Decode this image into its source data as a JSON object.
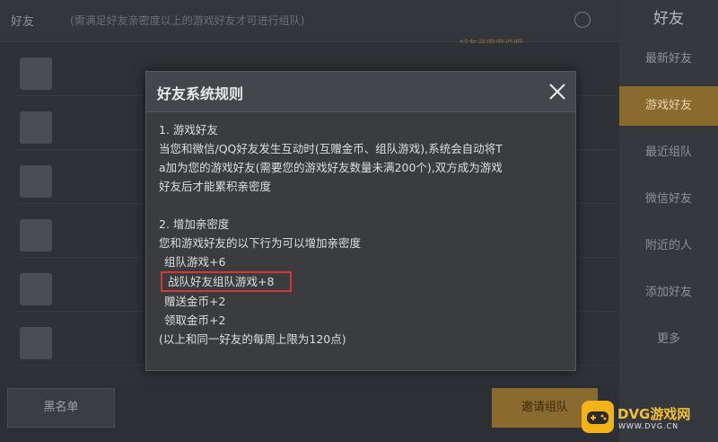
{
  "background": {
    "top_title": "好友",
    "top_hint": "(需满足好友亲密度以上的游戏好友才可进行组队)",
    "sub_hint": "好友亲密度说明",
    "bottom_left_button": "黑名单",
    "bottom_right_button": "邀请组队"
  },
  "sidebar": {
    "header": "好友",
    "items": [
      {
        "label": "最新好友"
      },
      {
        "label": "游戏好友"
      },
      {
        "label": "最近组队"
      },
      {
        "label": "微信好友"
      },
      {
        "label": "附近的人"
      },
      {
        "label": "添加好友"
      },
      {
        "label": "更多"
      }
    ]
  },
  "modal": {
    "title": "好友系统规则",
    "section1_title": "1. 游戏好友",
    "section1_line1": "当您和微信/QQ好友发生互动时(互赠金币、组队游戏),系统会自动将T",
    "section1_line2": "a加为您的游戏好友(需要您的游戏好友数量未满200个),双方成为游戏",
    "section1_line3": "好友后才能累积亲密度",
    "section2_title": "2. 增加亲密度",
    "section2_intro": "您和游戏好友的以下行为可以增加亲密度",
    "rule1": "组队游戏+6",
    "rule2": "战队好友组队游戏+8",
    "rule3": "赠送金币+2",
    "rule4": "领取金币+2",
    "limit": "(以上和同一好友的每周上限为120点)"
  },
  "watermark": {
    "brand": "DVG游戏网",
    "url": "WWW.DVG.CN"
  },
  "colors": {
    "highlight_border": "#d8362f",
    "accent_gold": "#8a6a2e",
    "watermark_yellow": "#f2b21a"
  }
}
